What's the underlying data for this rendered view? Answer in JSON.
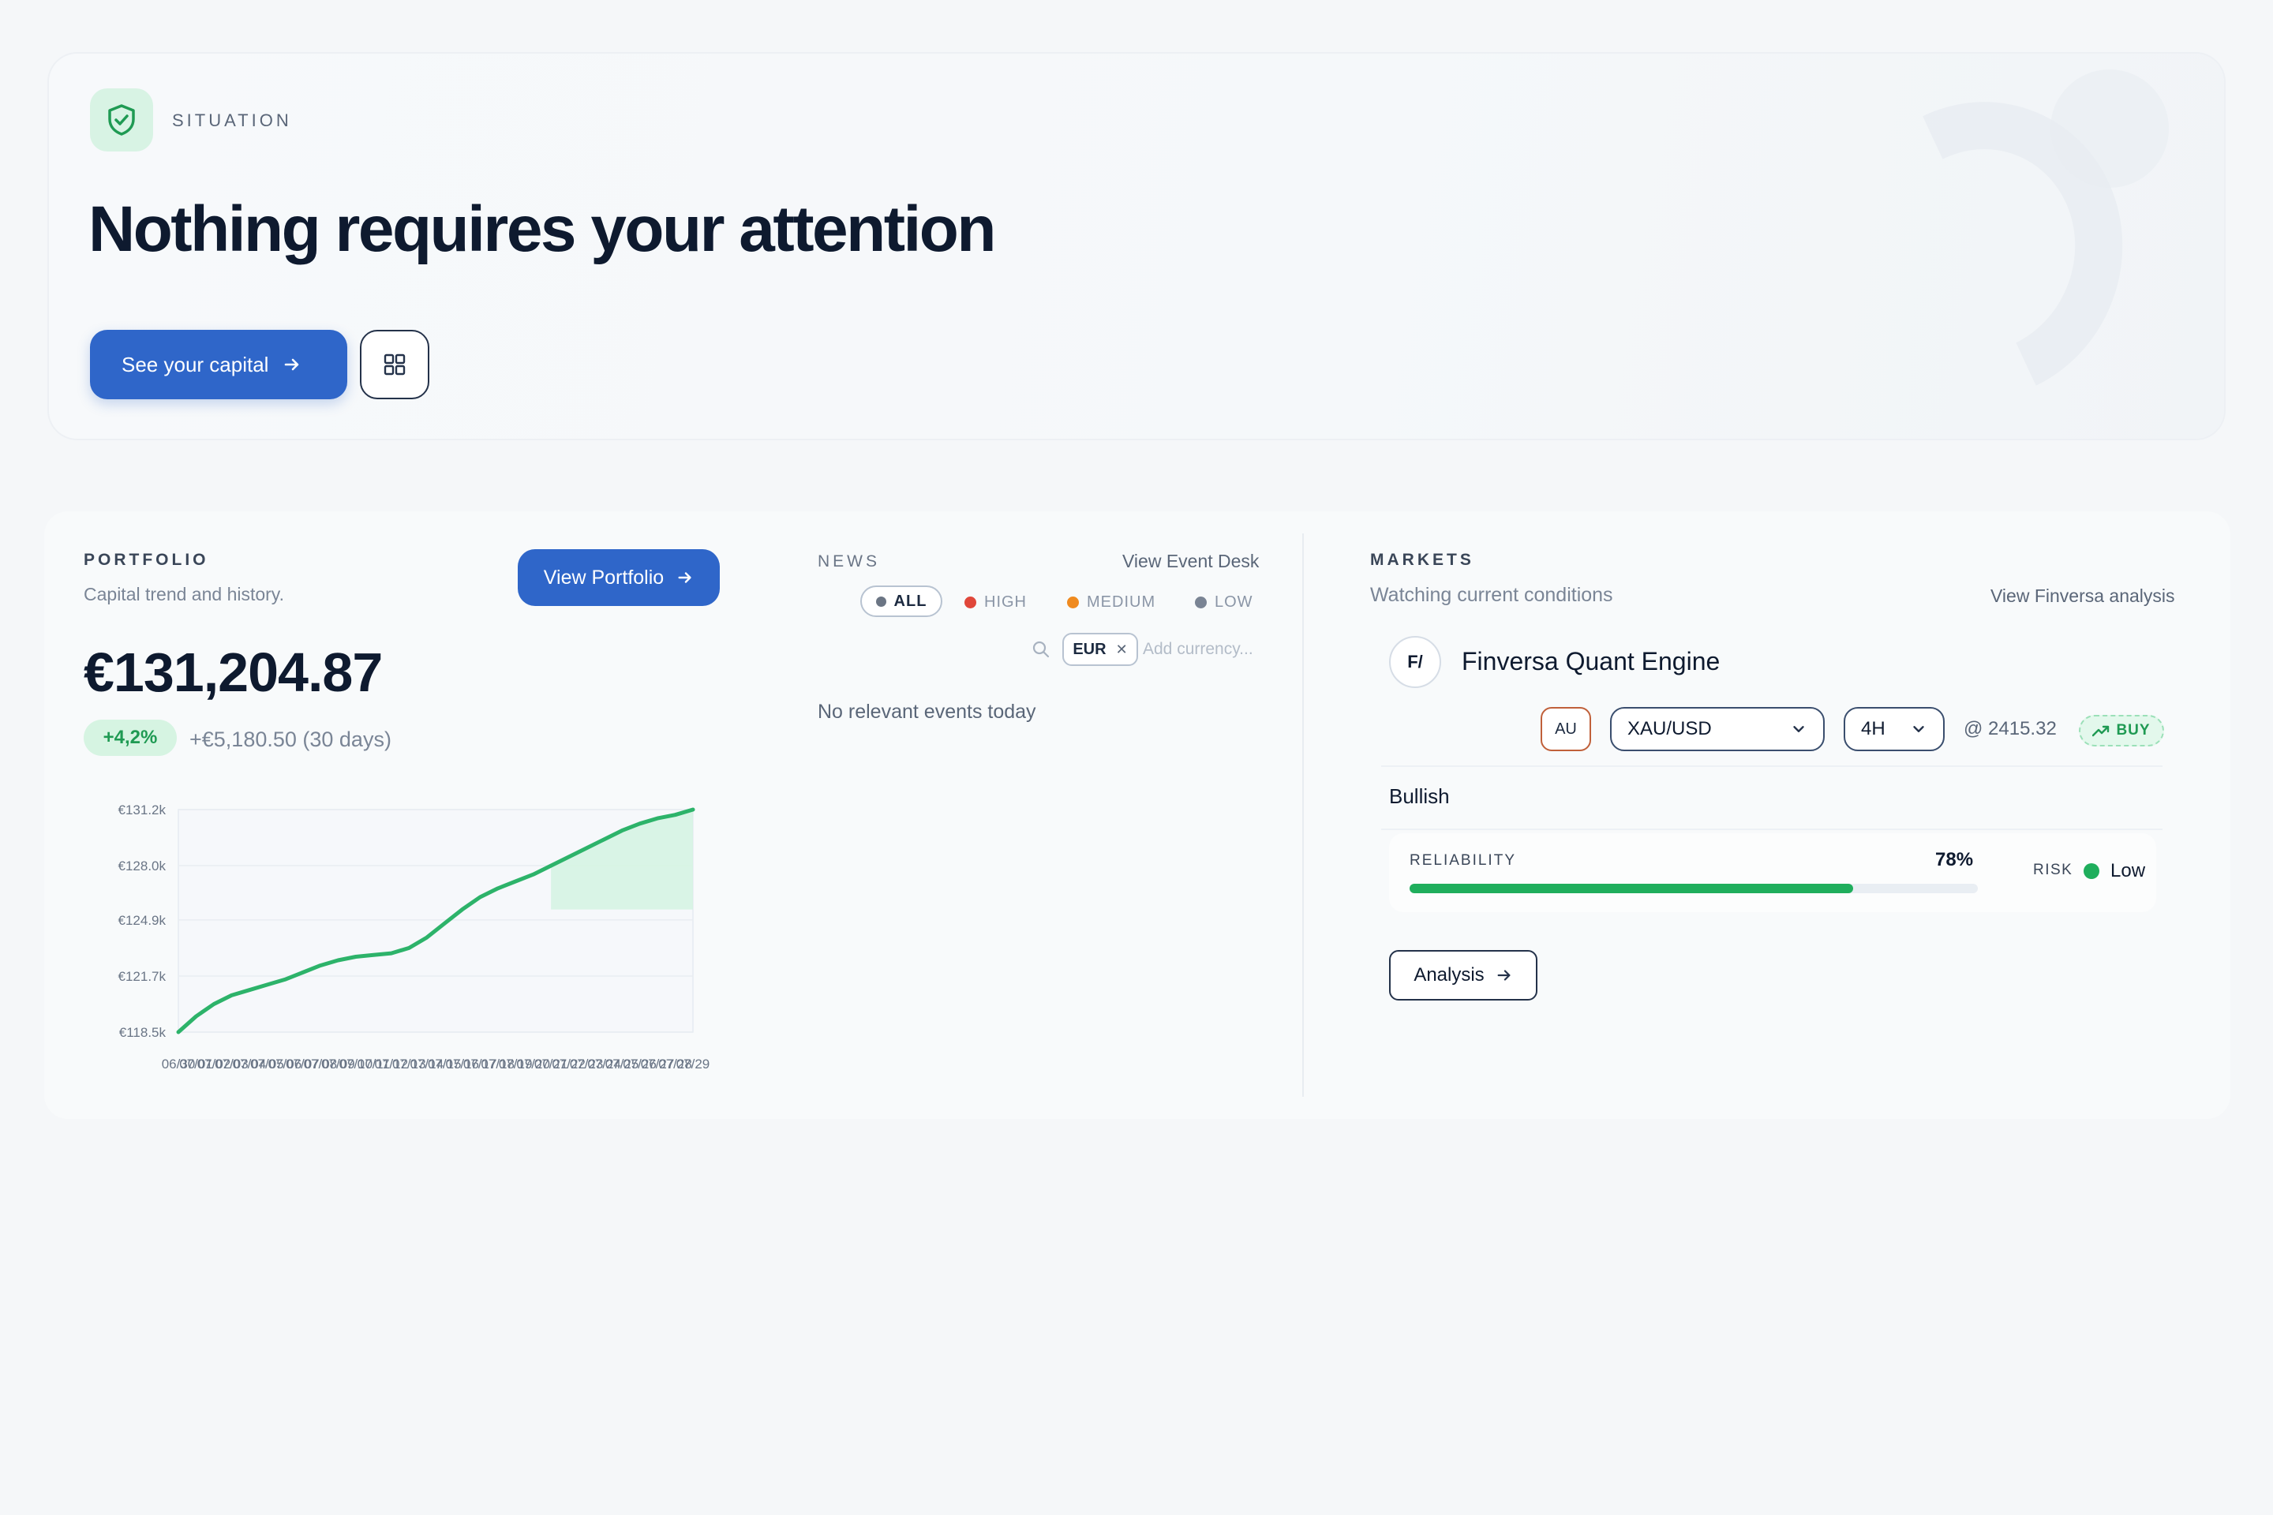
{
  "hero": {
    "label": "SITUATION",
    "title": "Nothing requires your attention",
    "primary_button": "See your capital",
    "icons": [
      "shield-check-icon",
      "arrow-right-icon",
      "grid-icon"
    ]
  },
  "portfolio": {
    "title": "PORTFOLIO",
    "subtitle": "Capital trend and history.",
    "view_button": "View Portfolio",
    "amount": "€131,204.87",
    "change_pct": "+4,2%",
    "change_abs": "+€5,180.50 (30 days)"
  },
  "news": {
    "title": "NEWS",
    "link": "View Event Desk",
    "filters": [
      {
        "label": "ALL",
        "color": "#6b7584"
      },
      {
        "label": "HIGH",
        "color": "#e0473a"
      },
      {
        "label": "MEDIUM",
        "color": "#ef8a1f"
      },
      {
        "label": "LOW",
        "color": "#7a8494"
      }
    ],
    "currency_chip": "EUR",
    "currency_placeholder": "Add currency...",
    "empty_text": "No relevant events today"
  },
  "markets": {
    "title": "MARKETS",
    "subtitle": "Watching current conditions",
    "link": "View Finversa analysis",
    "engine_logo": "F/",
    "engine_name": "Finversa Quant Engine",
    "symbol_badge": "AU",
    "pair": "XAU/USD",
    "timeframe": "4H",
    "price": "@ 2415.32",
    "signal": "BUY",
    "trend": "Bullish",
    "reliability_label": "RELIABILITY",
    "reliability_value": "78%",
    "reliability_fraction": 0.78,
    "risk_label": "RISK",
    "risk_value": "Low",
    "analysis_button": "Analysis"
  },
  "chart_data": {
    "type": "area",
    "title": "",
    "xlabel": "",
    "ylabel": "",
    "ylim": [
      118.5,
      131.2
    ],
    "y_ticks": [
      "€131.2k",
      "€128.0k",
      "€124.9k",
      "€121.7k",
      "€118.5k"
    ],
    "y_tick_values": [
      131.2,
      128.0,
      124.9,
      121.7,
      118.5
    ],
    "x": [
      "06/30",
      "07/01",
      "07/02",
      "07/03",
      "07/04",
      "07/05",
      "07/06",
      "07/07",
      "07/08",
      "07/09",
      "07/10",
      "07/11",
      "07/12",
      "07/13",
      "07/14",
      "07/15",
      "07/16",
      "07/17",
      "07/18",
      "07/19",
      "07/20",
      "07/21",
      "07/22",
      "07/23",
      "07/24",
      "07/25",
      "07/26",
      "07/27",
      "07/28",
      "07/29"
    ],
    "series": [
      {
        "values": [
          118.5,
          119.4,
          120.1,
          120.6,
          120.9,
          121.2,
          121.5,
          121.9,
          122.3,
          122.6,
          122.8,
          122.9,
          123.0,
          123.3,
          123.9,
          124.7,
          125.5,
          126.2,
          126.7,
          127.1,
          127.5,
          128.0,
          128.5,
          129.0,
          129.5,
          130.0,
          130.4,
          130.7,
          130.9,
          131.2
        ],
        "color": "#2db36a"
      }
    ],
    "grid": true
  }
}
